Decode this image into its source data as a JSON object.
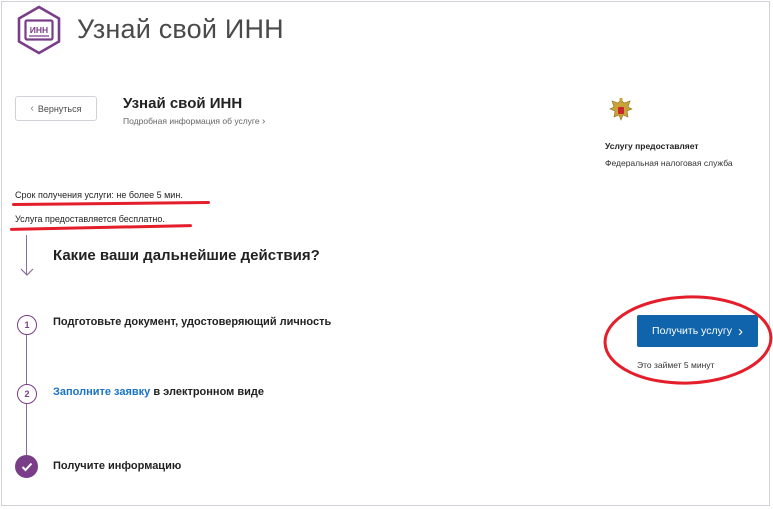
{
  "header": {
    "logo_text": "ИНН",
    "title": "Узнай свой ИНН"
  },
  "nav": {
    "back_label": "Вернуться"
  },
  "service": {
    "title": "Узнай свой ИНН",
    "details_link": "Подробная информация об услуге"
  },
  "provider": {
    "label": "Услугу предоставляет",
    "name": "Федеральная налоговая служба"
  },
  "info": {
    "term": "Срок получения услуги: не более 5 мин.",
    "cost": "Услуга предоставляется бесплатно."
  },
  "steps": {
    "heading": "Какие ваши дальнейшие действия?",
    "items": [
      {
        "number": "1",
        "text": "Подготовьте документ, удостоверяющий личность"
      },
      {
        "number": "2",
        "link": "Заполните заявку",
        "text": " в электронном виде"
      },
      {
        "text": "Получите информацию"
      }
    ]
  },
  "cta": {
    "label": "Получить услугу",
    "note": "Это займет 5 минут"
  },
  "colors": {
    "accent_purple": "#7a3e88",
    "primary_button": "#0f64ac",
    "link": "#1a73c7",
    "annotation_red": "#e41e2b"
  }
}
